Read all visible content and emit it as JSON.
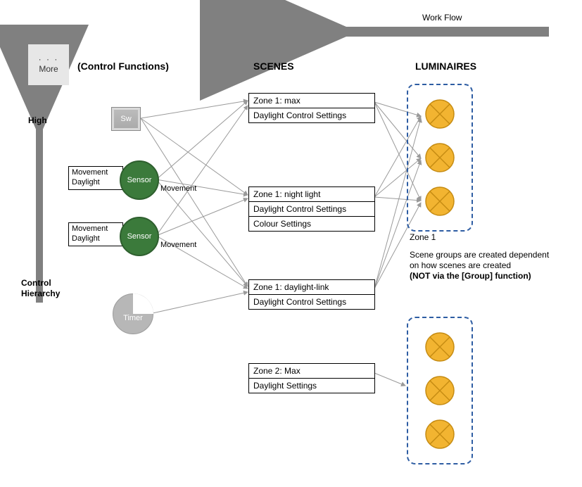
{
  "workflow_label": "Work Flow",
  "columns": {
    "control_functions": "(Control Functions)",
    "scenes": "SCENES",
    "luminaires": "LUMINAIRES"
  },
  "more_box": {
    "dots": "· · ·",
    "label": "More"
  },
  "hierarchy": {
    "high": "High",
    "title_line1": "Control",
    "title_line2": "Hierarchy"
  },
  "controls": {
    "switch": {
      "label": "Sw"
    },
    "sensor": {
      "box_line1": "Movement",
      "box_line2": "Daylight",
      "circle_label": "Sensor",
      "movement_word": "Movement"
    },
    "timer": {
      "label": "Timer"
    }
  },
  "scenes": {
    "s1": {
      "title": "Zone 1: max",
      "row2": "Daylight Control Settings"
    },
    "s2": {
      "title": "Zone 1: night light",
      "row2": "Daylight Control Settings",
      "row3": "Colour Settings"
    },
    "s3": {
      "title": "Zone 1: daylight-link",
      "row2": "Daylight Control Settings"
    },
    "s4": {
      "title": "Zone 2: Max",
      "row2": "Daylight Settings"
    }
  },
  "luminaires": {
    "zone1_label": "Zone 1",
    "note_line1": "Scene groups are created dependent",
    "note_line2": "on how scenes are created",
    "note_line3": "(NOT via the [Group] function)"
  },
  "chart_data": {
    "type": "diagram",
    "title": "Control hierarchy: controls → scenes → luminaires",
    "columns": [
      "Control Functions",
      "SCENES",
      "LUMINAIRES"
    ],
    "workflow_direction": "right-to-left (Luminaires → Scenes → Controls)",
    "control_hierarchy_axis": "vertical, High at top",
    "controls": [
      {
        "id": "switch",
        "type": "switch",
        "label": "Sw"
      },
      {
        "id": "sensor1",
        "type": "sensor",
        "outputs": [
          "Movement",
          "Daylight"
        ],
        "edge_label": "Movement"
      },
      {
        "id": "sensor2",
        "type": "sensor",
        "outputs": [
          "Movement",
          "Daylight"
        ],
        "edge_label": "Movement"
      },
      {
        "id": "timer",
        "type": "timer",
        "label": "Timer"
      }
    ],
    "scenes": [
      {
        "id": "s1",
        "title": "Zone 1: max",
        "settings": [
          "Daylight Control Settings"
        ]
      },
      {
        "id": "s2",
        "title": "Zone 1: night light",
        "settings": [
          "Daylight Control Settings",
          "Colour Settings"
        ]
      },
      {
        "id": "s3",
        "title": "Zone 1: daylight-link",
        "settings": [
          "Daylight Control Settings"
        ]
      },
      {
        "id": "s4",
        "title": "Zone 2: Max",
        "settings": [
          "Daylight Settings"
        ]
      }
    ],
    "luminaire_groups": [
      {
        "id": "zone1",
        "label": "Zone 1",
        "luminaire_count": 3
      },
      {
        "id": "zone2",
        "label": null,
        "luminaire_count": 3
      }
    ],
    "edges_controls_to_scenes": [
      {
        "from": "switch",
        "to": "s1"
      },
      {
        "from": "switch",
        "to": "s2"
      },
      {
        "from": "switch",
        "to": "s3"
      },
      {
        "from": "sensor1",
        "to": "s1",
        "label": "Movement"
      },
      {
        "from": "sensor1",
        "to": "s2",
        "label": "Movement"
      },
      {
        "from": "sensor1",
        "to": "s3",
        "label": "Movement"
      },
      {
        "from": "sensor2",
        "to": "s1",
        "label": "Movement"
      },
      {
        "from": "sensor2",
        "to": "s2",
        "label": "Movement"
      },
      {
        "from": "sensor2",
        "to": "s3",
        "label": "Movement"
      },
      {
        "from": "timer",
        "to": "s3"
      }
    ],
    "edges_scenes_to_luminaires": [
      {
        "from": "s1",
        "to_group": "zone1",
        "to_luminaires": [
          1,
          2,
          3
        ]
      },
      {
        "from": "s2",
        "to_group": "zone1",
        "to_luminaires": [
          1,
          2,
          3
        ]
      },
      {
        "from": "s3",
        "to_group": "zone1",
        "to_luminaires": [
          1,
          2,
          3
        ]
      },
      {
        "from": "s4",
        "to_group": "zone2",
        "to_luminaires": [
          2
        ]
      }
    ],
    "note": "Scene groups are created dependent on how scenes are created (NOT via the [Group] function)"
  }
}
